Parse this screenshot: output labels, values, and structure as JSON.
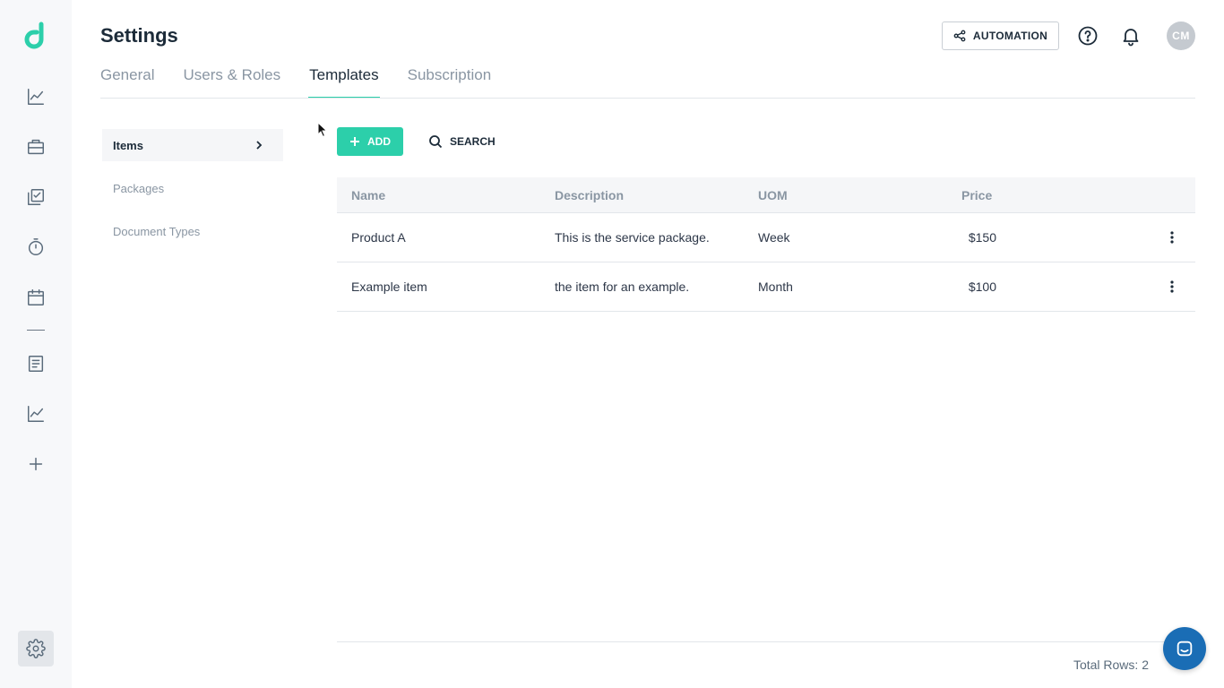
{
  "brand": {
    "accent": "#2ccfaa",
    "chat_color": "#1a6db5"
  },
  "sidebar": {
    "logo_icon": "d-logo-icon",
    "items": [
      {
        "name": "dashboard-chart",
        "icon": "line-chart-icon"
      },
      {
        "name": "jobs",
        "icon": "briefcase-icon"
      },
      {
        "name": "tasks",
        "icon": "checklist-icon"
      },
      {
        "name": "time-tracking",
        "icon": "stopwatch-icon"
      },
      {
        "name": "calendar",
        "icon": "calendar-icon"
      },
      {
        "name": "documents",
        "icon": "document-icon"
      },
      {
        "name": "reports",
        "icon": "line-chart-icon"
      },
      {
        "name": "add",
        "icon": "plus-icon"
      }
    ],
    "settings_icon": "gear-icon"
  },
  "header": {
    "title": "Settings",
    "automation_label": "AUTOMATION",
    "avatar_initials": "CM"
  },
  "tabs": [
    {
      "label": "General",
      "active": false
    },
    {
      "label": "Users & Roles",
      "active": false
    },
    {
      "label": "Templates",
      "active": true
    },
    {
      "label": "Subscription",
      "active": false
    }
  ],
  "submenu": [
    {
      "label": "Items",
      "active": true
    },
    {
      "label": "Packages",
      "active": false
    },
    {
      "label": "Document Types",
      "active": false
    }
  ],
  "toolbar": {
    "add_label": "ADD",
    "search_label": "SEARCH"
  },
  "table": {
    "columns": [
      "Name",
      "Description",
      "UOM",
      "Price"
    ],
    "rows": [
      {
        "name": "Product A",
        "description": "This is the service package.",
        "uom": "Week",
        "price": "$150"
      },
      {
        "name": "Example item",
        "description": "the item for an example.",
        "uom": "Month",
        "price": "$100"
      }
    ],
    "total_rows": "Total Rows: 2"
  }
}
